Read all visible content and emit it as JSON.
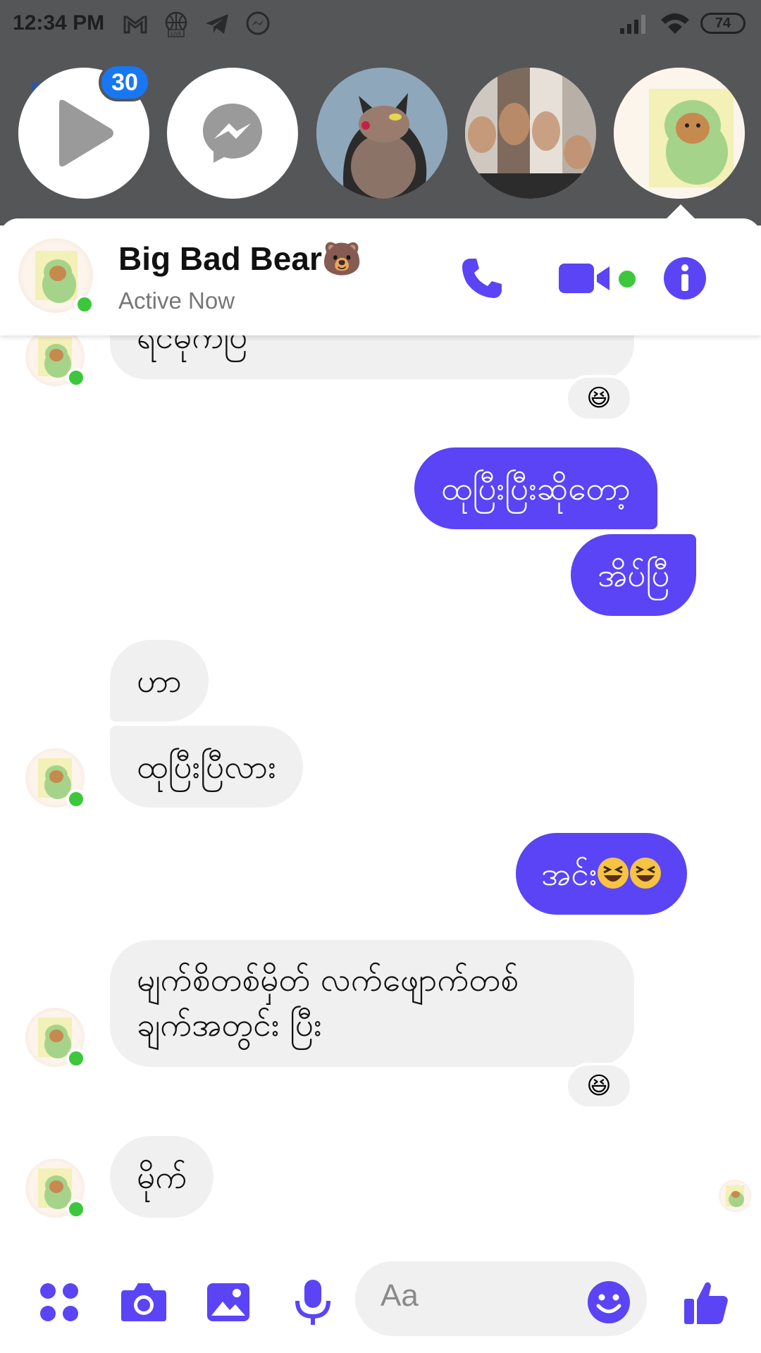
{
  "status_bar": {
    "time": "12:34 PM",
    "battery": "74",
    "left_icons": [
      "gmail-icon",
      "live-icon",
      "telegram-icon",
      "messenger-icon"
    ],
    "right_icons": [
      "signal-icon",
      "wifi-icon"
    ]
  },
  "chat_heads": {
    "badge_count": "30",
    "items": [
      "video-play-head",
      "messenger-head",
      "cat-avatar-head",
      "group-photo-head",
      "dino-avatar-head"
    ]
  },
  "chat_header": {
    "contact_name": "Big Bad Bear🐻",
    "status": "Active Now"
  },
  "messages": [
    {
      "from": "them",
      "text": "ရင်မိုက်ပြ",
      "reaction": "😆"
    },
    {
      "from": "me",
      "text": "ထုပြီးပြီးဆိုတော့"
    },
    {
      "from": "me",
      "text": "အိပ်ပြီ"
    },
    {
      "from": "them",
      "text": "ဟာ"
    },
    {
      "from": "them",
      "text": "ထုပြီးပြီလား"
    },
    {
      "from": "me",
      "text": "အင်း"
    },
    {
      "from": "them",
      "text_line1": "မျက်စိတစ်မှိတ် လက်ဖျောက်တစ်",
      "text_line2": "ချက်အတွင်း ပြီး",
      "reaction": "😆"
    },
    {
      "from": "them",
      "text": "မိုက်"
    }
  ],
  "composer": {
    "placeholder": "Aa"
  },
  "colors": {
    "accent": "#5a44f5",
    "online": "#3cc73c",
    "badge": "#1877f2",
    "incoming_bubble": "#f0f0f0"
  }
}
